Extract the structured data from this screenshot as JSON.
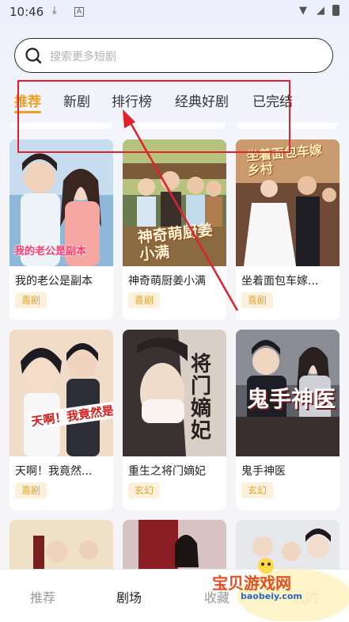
{
  "status_bar": {
    "time": "10:46"
  },
  "search": {
    "placeholder": "搜索更多短剧"
  },
  "tabs": [
    {
      "label": "推荐"
    },
    {
      "label": "新剧"
    },
    {
      "label": "排行榜"
    },
    {
      "label": "经典好剧"
    },
    {
      "label": "已完结"
    }
  ],
  "cards": [
    {
      "title": "我的老公是副本",
      "tag": "喜剧",
      "poster_text": "我的老公是副本"
    },
    {
      "title": "神奇萌厨姜小满",
      "tag": "喜剧",
      "poster_text": "神奇萌厨姜小满"
    },
    {
      "title": "坐着面包车嫁...",
      "tag": "喜剧",
      "poster_text": "坐着面包车嫁乡村"
    },
    {
      "title": "天啊！我竟然...",
      "tag": "喜剧",
      "poster_text": "天啊！我竟然是炮灰"
    },
    {
      "title": "重生之将门嫡妃",
      "tag": "玄幻",
      "poster_text": "将门嫡妃"
    },
    {
      "title": "鬼手神医",
      "tag": "玄幻",
      "poster_text": "鬼手神医"
    }
  ],
  "bottom_nav": [
    {
      "label": "推荐"
    },
    {
      "label": "剧场"
    },
    {
      "label": "收藏"
    },
    {
      "label": "我的"
    }
  ],
  "watermark": {
    "text": "宝贝游戏网",
    "url": "baobeiy.com"
  },
  "colors": {
    "accent": "#f0a020",
    "annotation": "#e0212d",
    "tag_text": "#e4a230",
    "tag_bg": "#fdf1dc"
  }
}
